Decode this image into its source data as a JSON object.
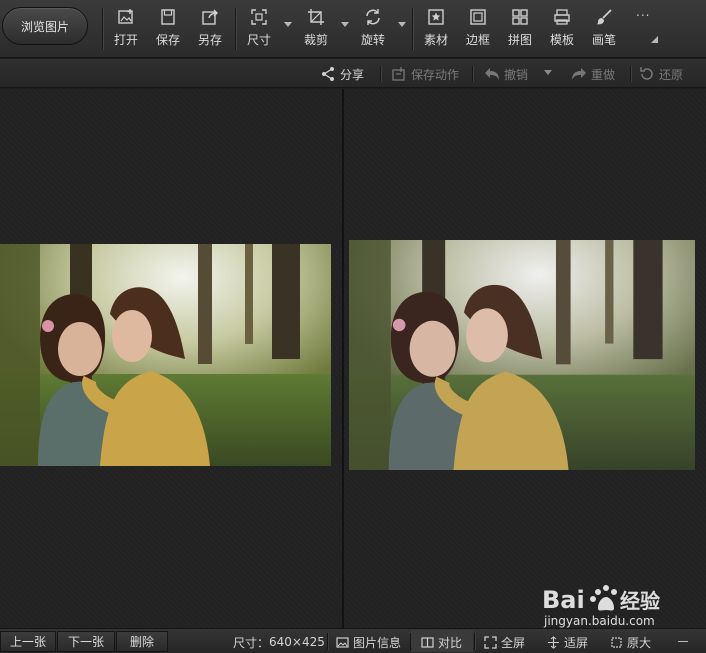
{
  "toolbar": {
    "browse": "浏览图片",
    "tools": [
      {
        "label": "打开",
        "icon": "open-image-icon"
      },
      {
        "label": "保存",
        "icon": "save-disk-icon"
      },
      {
        "label": "另存",
        "icon": "save-as-icon"
      },
      {
        "label": "尺寸",
        "icon": "resize-icon"
      },
      {
        "label": "裁剪",
        "icon": "crop-icon"
      },
      {
        "label": "旋转",
        "icon": "rotate-icon"
      },
      {
        "label": "素材",
        "icon": "star-material-icon"
      },
      {
        "label": "边框",
        "icon": "frame-icon"
      },
      {
        "label": "拼图",
        "icon": "collage-grid-icon"
      },
      {
        "label": "模板",
        "icon": "template-printer-icon"
      },
      {
        "label": "画笔",
        "icon": "brush-icon"
      },
      {
        "label": "...",
        "icon": "more-dots-icon"
      }
    ]
  },
  "subbar": {
    "share": "分享",
    "save_action": "保存动作",
    "undo": "撤销",
    "redo": "重做",
    "restore": "还原"
  },
  "bottombar": {
    "prev": "上一张",
    "next": "下一张",
    "delete": "删除",
    "size_label": "尺寸：",
    "size_value": "640×425",
    "image_info": "图片信息",
    "compare": "对比",
    "fullscreen": "全屏",
    "fit_screen": "适屏",
    "original_size": "原大"
  },
  "watermark": {
    "brand": "Bai",
    "brand_cn": "经验",
    "url": "jingyan.baidu.com"
  },
  "colors": {
    "background": "#1e1e1e",
    "toolbar": "#333333",
    "text": "#d8d8d8",
    "disabled_text": "#7a7a7a"
  }
}
